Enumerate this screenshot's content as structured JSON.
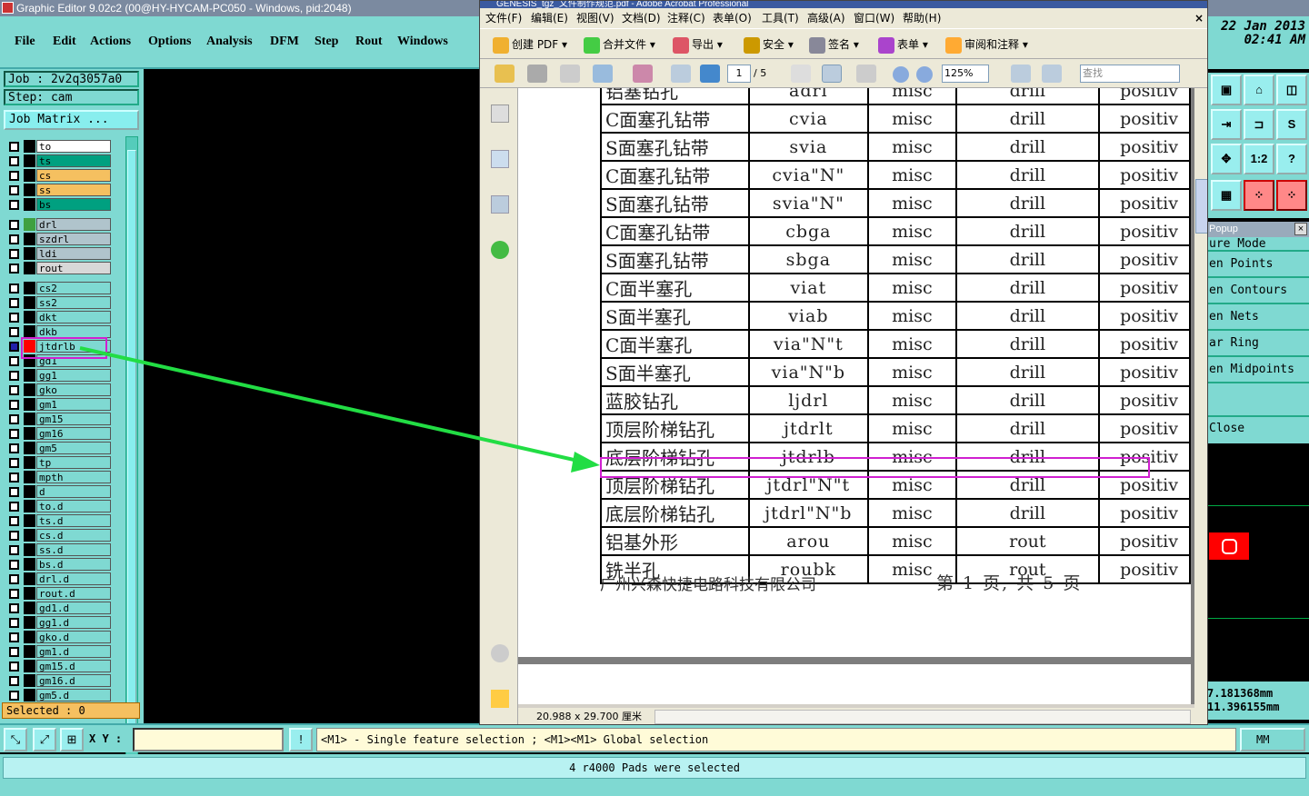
{
  "genesis": {
    "title": "Graphic Editor 9.02c2 (00@HY-HYCAM-PC050 - Windows, pid:2048)",
    "menu": [
      "File",
      "Edit",
      "Actions",
      "Options",
      "Analysis",
      "DFM",
      "Step",
      "Rout",
      "Windows"
    ],
    "job": "Job : 2v2q3057a0",
    "step": "Step: cam",
    "job_matrix": "Job Matrix ...",
    "layers": [
      {
        "name": "to",
        "color": "#ffffff"
      },
      {
        "name": "ts",
        "color": "#00a080"
      },
      {
        "name": "cs",
        "color": "#f5c060"
      },
      {
        "name": "ss",
        "color": "#f5c060"
      },
      {
        "name": "bs",
        "color": "#00a080"
      },
      {
        "name": "drl",
        "color": "#b0c4cc",
        "swatch": "#40a040"
      },
      {
        "name": "szdrl",
        "color": "#b0c4cc"
      },
      {
        "name": "ldi",
        "color": "#b0c4cc"
      },
      {
        "name": "rout",
        "color": "#d8d8d8"
      },
      {
        "name": "cs2",
        "color": "#7fd9d2"
      },
      {
        "name": "ss2",
        "color": "#7fd9d2"
      },
      {
        "name": "dkt",
        "color": "#7fd9d2"
      },
      {
        "name": "dkb",
        "color": "#7fd9d2"
      },
      {
        "name": "jtdrlb",
        "color": "#7fd9d2",
        "swatch": "#ff0000"
      },
      {
        "name": "gd1",
        "color": "#7fd9d2"
      },
      {
        "name": "gg1",
        "color": "#7fd9d2"
      },
      {
        "name": "gko",
        "color": "#7fd9d2"
      },
      {
        "name": "gm1",
        "color": "#7fd9d2"
      },
      {
        "name": "gm15",
        "color": "#7fd9d2"
      },
      {
        "name": "gm16",
        "color": "#7fd9d2"
      },
      {
        "name": "gm5",
        "color": "#7fd9d2"
      },
      {
        "name": "tp",
        "color": "#7fd9d2"
      },
      {
        "name": "mpth",
        "color": "#7fd9d2"
      },
      {
        "name": "d",
        "color": "#7fd9d2"
      },
      {
        "name": "to.d",
        "color": "#7fd9d2"
      },
      {
        "name": "ts.d",
        "color": "#7fd9d2"
      },
      {
        "name": "cs.d",
        "color": "#7fd9d2"
      },
      {
        "name": "ss.d",
        "color": "#7fd9d2"
      },
      {
        "name": "bs.d",
        "color": "#7fd9d2"
      },
      {
        "name": "drl.d",
        "color": "#7fd9d2"
      },
      {
        "name": "rout.d",
        "color": "#7fd9d2"
      },
      {
        "name": "gd1.d",
        "color": "#7fd9d2"
      },
      {
        "name": "gg1.d",
        "color": "#7fd9d2"
      },
      {
        "name": "gko.d",
        "color": "#7fd9d2"
      },
      {
        "name": "gm1.d",
        "color": "#7fd9d2"
      },
      {
        "name": "gm15.d",
        "color": "#7fd9d2"
      },
      {
        "name": "gm16.d",
        "color": "#7fd9d2"
      },
      {
        "name": "gm5.d",
        "color": "#7fd9d2"
      }
    ],
    "selected": "Selected : 0",
    "date": "22 Jan 2013",
    "time": "02:41 AM",
    "popup_title": "Popup",
    "popup_items": [
      "ure Mode",
      "en Points",
      "en Contours",
      "en Nets",
      "ar Ring",
      "en Midpoints"
    ],
    "popup_close": "Close",
    "coord_x": "7.181368mm",
    "coord_y": "11.396155mm",
    "xy_label": "X Y :",
    "help_text": "<M1> - Single feature selection ; <M1><M1> Global selection",
    "unit": "MM",
    "status": "4 r4000 Pads were selected"
  },
  "acrobat": {
    "title": "GENESIS_tgz_文件制作规范.pdf - Adobe Acrobat Professional",
    "menu": [
      "文件(F)",
      "编辑(E)",
      "视图(V)",
      "文档(D)",
      "注释(C)",
      "表单(O)",
      "工具(T)",
      "高级(A)",
      "窗口(W)",
      "帮助(H)"
    ],
    "toolbar": [
      "创建 PDF",
      "合并文件",
      "导出",
      "安全",
      "签名",
      "表单",
      "审阅和注释"
    ],
    "page_current": "1",
    "page_total": "/ 5",
    "zoom": "125%",
    "search_placeholder": "查找",
    "page_size": "20.988 x 29.700 厘米",
    "footer_company": "广州兴森快捷电路科技有限公司",
    "footer_page": "第 1 页, 共 5 页",
    "rows": [
      [
        "铝塞钻孔",
        "adrl",
        "misc",
        "drill",
        "positiv"
      ],
      [
        "C面塞孔钻带",
        "cvia",
        "misc",
        "drill",
        "positiv"
      ],
      [
        "S面塞孔钻带",
        "svia",
        "misc",
        "drill",
        "positiv"
      ],
      [
        "C面塞孔钻带",
        "cvia\"N\"",
        "misc",
        "drill",
        "positiv"
      ],
      [
        "S面塞孔钻带",
        "svia\"N\"",
        "misc",
        "drill",
        "positiv"
      ],
      [
        "C面塞孔钻带",
        "cbga",
        "misc",
        "drill",
        "positiv"
      ],
      [
        "S面塞孔钻带",
        "sbga",
        "misc",
        "drill",
        "positiv"
      ],
      [
        "C面半塞孔",
        "viat",
        "misc",
        "drill",
        "positiv"
      ],
      [
        "S面半塞孔",
        "viab",
        "misc",
        "drill",
        "positiv"
      ],
      [
        "C面半塞孔",
        "via\"N\"t",
        "misc",
        "drill",
        "positiv"
      ],
      [
        "S面半塞孔",
        "via\"N\"b",
        "misc",
        "drill",
        "positiv"
      ],
      [
        "蓝胶钻孔",
        "ljdrl",
        "misc",
        "drill",
        "positiv"
      ],
      [
        "顶层阶梯钻孔",
        "jtdrlt",
        "misc",
        "drill",
        "positiv"
      ],
      [
        "底层阶梯钻孔",
        "jtdrlb",
        "misc",
        "drill",
        "positiv"
      ],
      [
        "顶层阶梯钻孔",
        "jtdrl\"N\"t",
        "misc",
        "drill",
        "positiv"
      ],
      [
        "底层阶梯钻孔",
        "jtdrl\"N\"b",
        "misc",
        "drill",
        "positiv"
      ],
      [
        "铝基外形",
        "arou",
        "misc",
        "rout",
        "positiv"
      ],
      [
        "铣半孔",
        "roubk",
        "misc",
        "rout",
        "positiv"
      ]
    ]
  }
}
